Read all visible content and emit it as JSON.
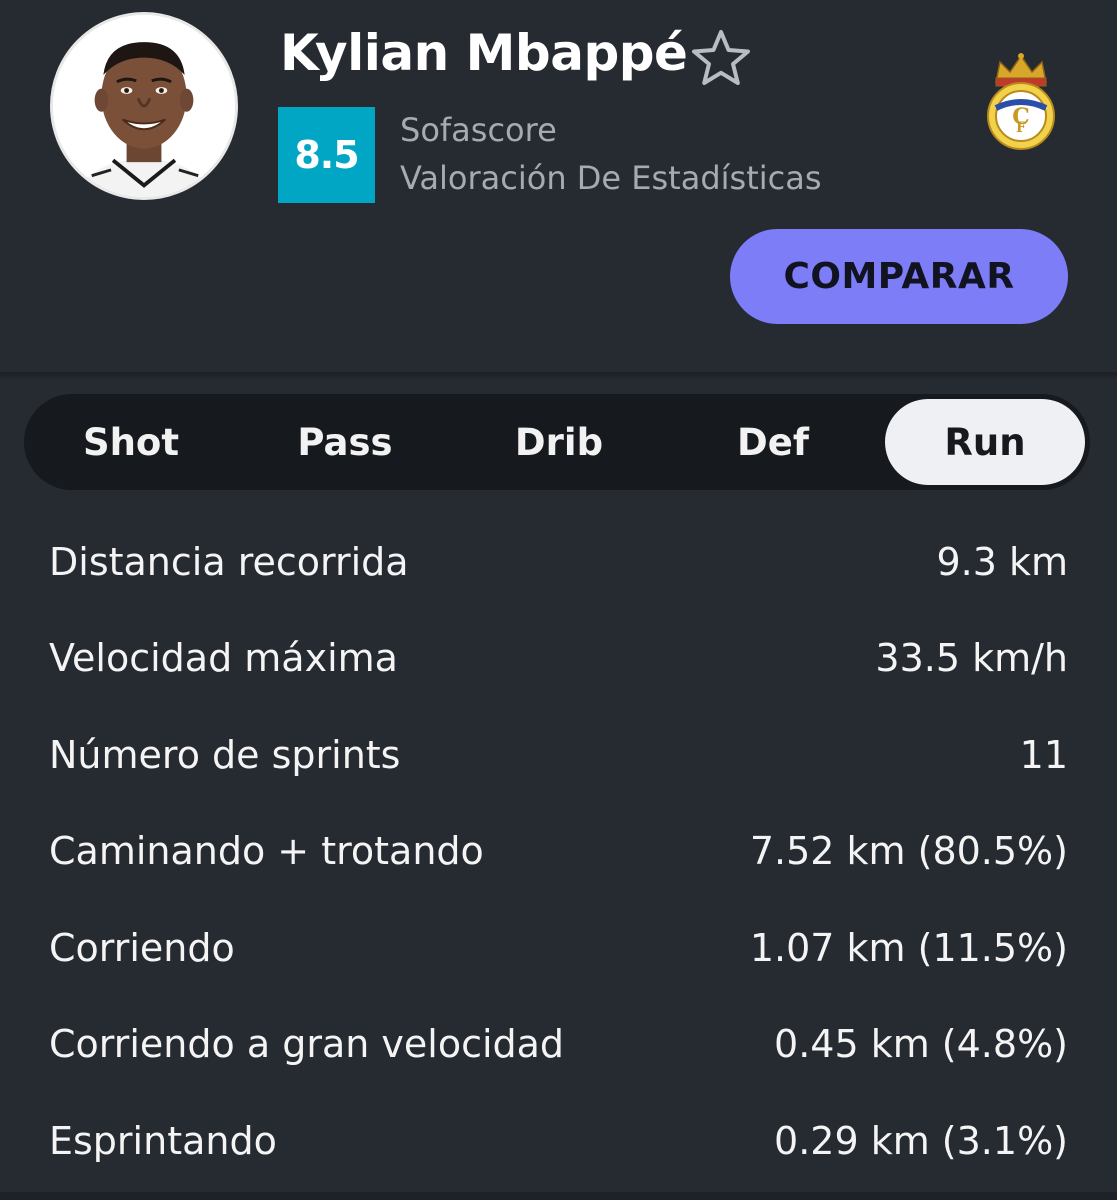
{
  "player": {
    "name": "Kylian Mbappé",
    "rating": "8.5",
    "rating_source": "Sofascore",
    "rating_label": "Valoración De Estadísticas"
  },
  "actions": {
    "compare_label": "COMPARAR"
  },
  "tabs": [
    {
      "label": "Shot",
      "active": false
    },
    {
      "label": "Pass",
      "active": false
    },
    {
      "label": "Drib",
      "active": false
    },
    {
      "label": "Def",
      "active": false
    },
    {
      "label": "Run",
      "active": true
    }
  ],
  "stats": [
    {
      "label": "Distancia recorrida",
      "value": "9.3 km"
    },
    {
      "label": "Velocidad máxima",
      "value": "33.5 km/h"
    },
    {
      "label": "Número de sprints",
      "value": "11"
    },
    {
      "label": "Caminando + trotando",
      "value": "7.52 km (80.5%)"
    },
    {
      "label": "Corriendo",
      "value": "1.07 km (11.5%)"
    },
    {
      "label": "Corriendo a gran velocidad",
      "value": "0.45 km (4.8%)"
    },
    {
      "label": "Esprintando",
      "value": "0.29 km (3.1%)"
    }
  ],
  "icons": {
    "favorite": "star-outline-icon",
    "club": "real-madrid-crest-icon"
  },
  "colors": {
    "background": "#262a31",
    "rating_badge": "#00a6c3",
    "accent_button": "#7d7ef7",
    "tab_bar": "#16191e",
    "tab_active": "#eef0f3"
  }
}
